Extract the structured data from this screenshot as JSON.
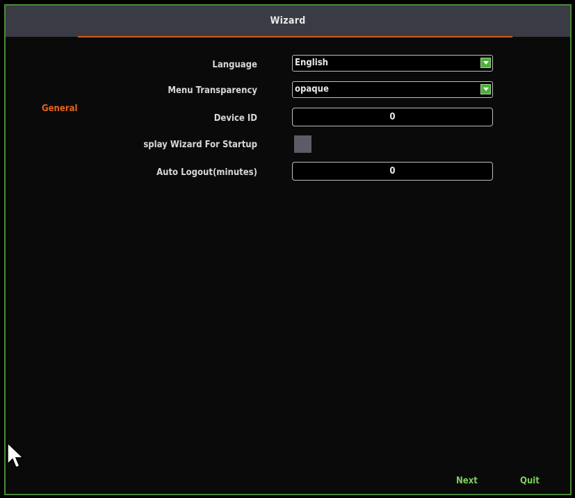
{
  "window": {
    "title": "Wizard"
  },
  "sidebar": {
    "items": [
      {
        "label": "General"
      }
    ]
  },
  "form": {
    "language": {
      "label": "Language",
      "value": "English"
    },
    "menu_transparency": {
      "label": "Menu Transparency",
      "value": "opaque"
    },
    "device_id": {
      "label": "Device ID",
      "value": "0"
    },
    "display_wizard": {
      "label": "splay Wizard For Startup",
      "checked": false
    },
    "auto_logout": {
      "label": "Auto Logout(minutes)",
      "value": "0"
    }
  },
  "footer": {
    "next_label": "Next",
    "quit_label": "Quit"
  },
  "colors": {
    "accent": "#d45a16",
    "titlebar": "#3b3b45",
    "button_text": "#7fd05a",
    "dropdown_arrow": "#4caf3a"
  },
  "icons": {
    "dropdown": "chevron-down-icon",
    "cursor": "mouse-pointer-icon"
  }
}
